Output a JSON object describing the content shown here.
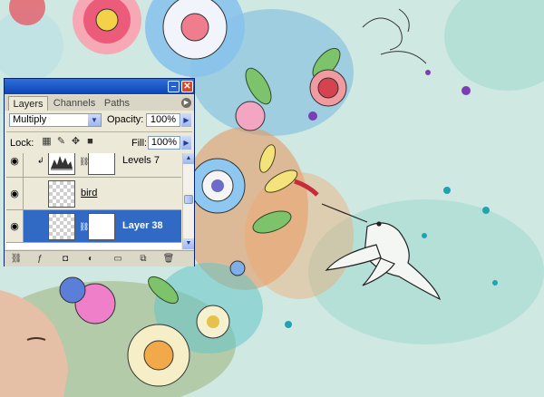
{
  "palette": {
    "tabs": [
      "Layers",
      "Channels",
      "Paths"
    ],
    "active_tab": "Layers",
    "title_buttons": {
      "minimize": "–",
      "close": "✕"
    },
    "menu_arrow_icon": "flyout-menu-icon",
    "blend_mode": "Multiply",
    "opacity_label": "Opacity:",
    "opacity_value": "100%",
    "lock_label": "Lock:",
    "fill_label": "Fill:",
    "fill_value": "100%",
    "layers": [
      {
        "name": "Levels 7",
        "type": "adjustment",
        "clipped": true,
        "visible": true,
        "selected": false
      },
      {
        "name": "bird",
        "type": "pixel",
        "visible": true,
        "selected": false
      },
      {
        "name": "Layer 38",
        "type": "pixel-with-mask",
        "visible": true,
        "selected": true
      }
    ],
    "bottom_icons": [
      "link-layers-icon",
      "layer-style-icon",
      "add-mask-icon",
      "adjustment-layer-icon",
      "new-group-icon",
      "new-layer-icon",
      "trash-icon"
    ]
  },
  "colors": {
    "titlebar": "#0c44b5",
    "panel_bg": "#ece9d8",
    "selection": "#316ac5",
    "canvas_bg": "#cfe9e2"
  }
}
